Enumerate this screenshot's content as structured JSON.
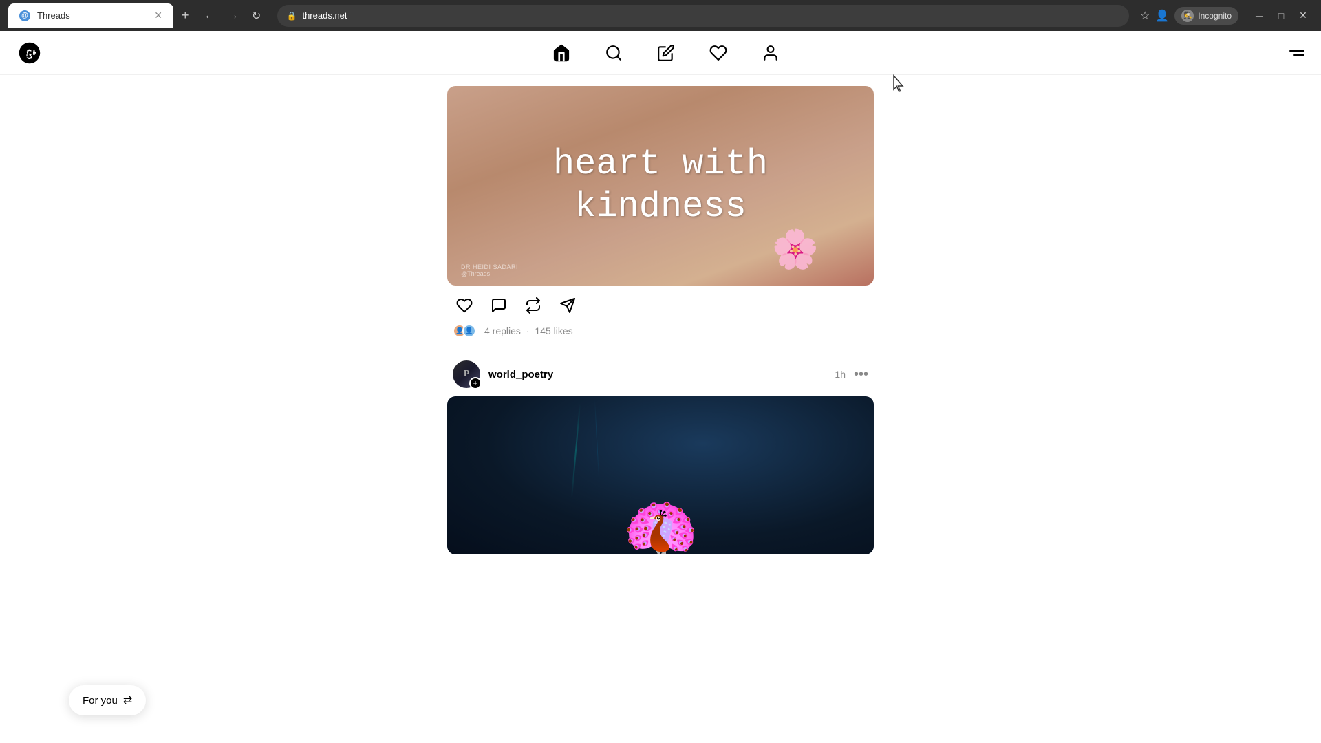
{
  "browser": {
    "tab_title": "Threads",
    "tab_favicon": "@",
    "url": "threads.net",
    "new_tab_label": "+",
    "incognito_label": "Incognito",
    "window_controls": [
      "─",
      "□",
      "✕"
    ]
  },
  "nav": {
    "logo_symbol": "@",
    "menu_label": "Menu"
  },
  "posts": [
    {
      "id": "post1",
      "username": "",
      "time": "",
      "image_text_line1": "heart with",
      "image_text_line2": "kindness",
      "credit_line1": "DR HEIDI SADARI",
      "credit_line2": "@Threads",
      "replies_count": "4 replies",
      "dot": "·",
      "likes_count": "145 likes"
    },
    {
      "id": "post2",
      "username": "world_poetry",
      "time": "1h",
      "more_btn": "···"
    }
  ],
  "for_you": {
    "label": "For you",
    "icon": "⇄"
  }
}
